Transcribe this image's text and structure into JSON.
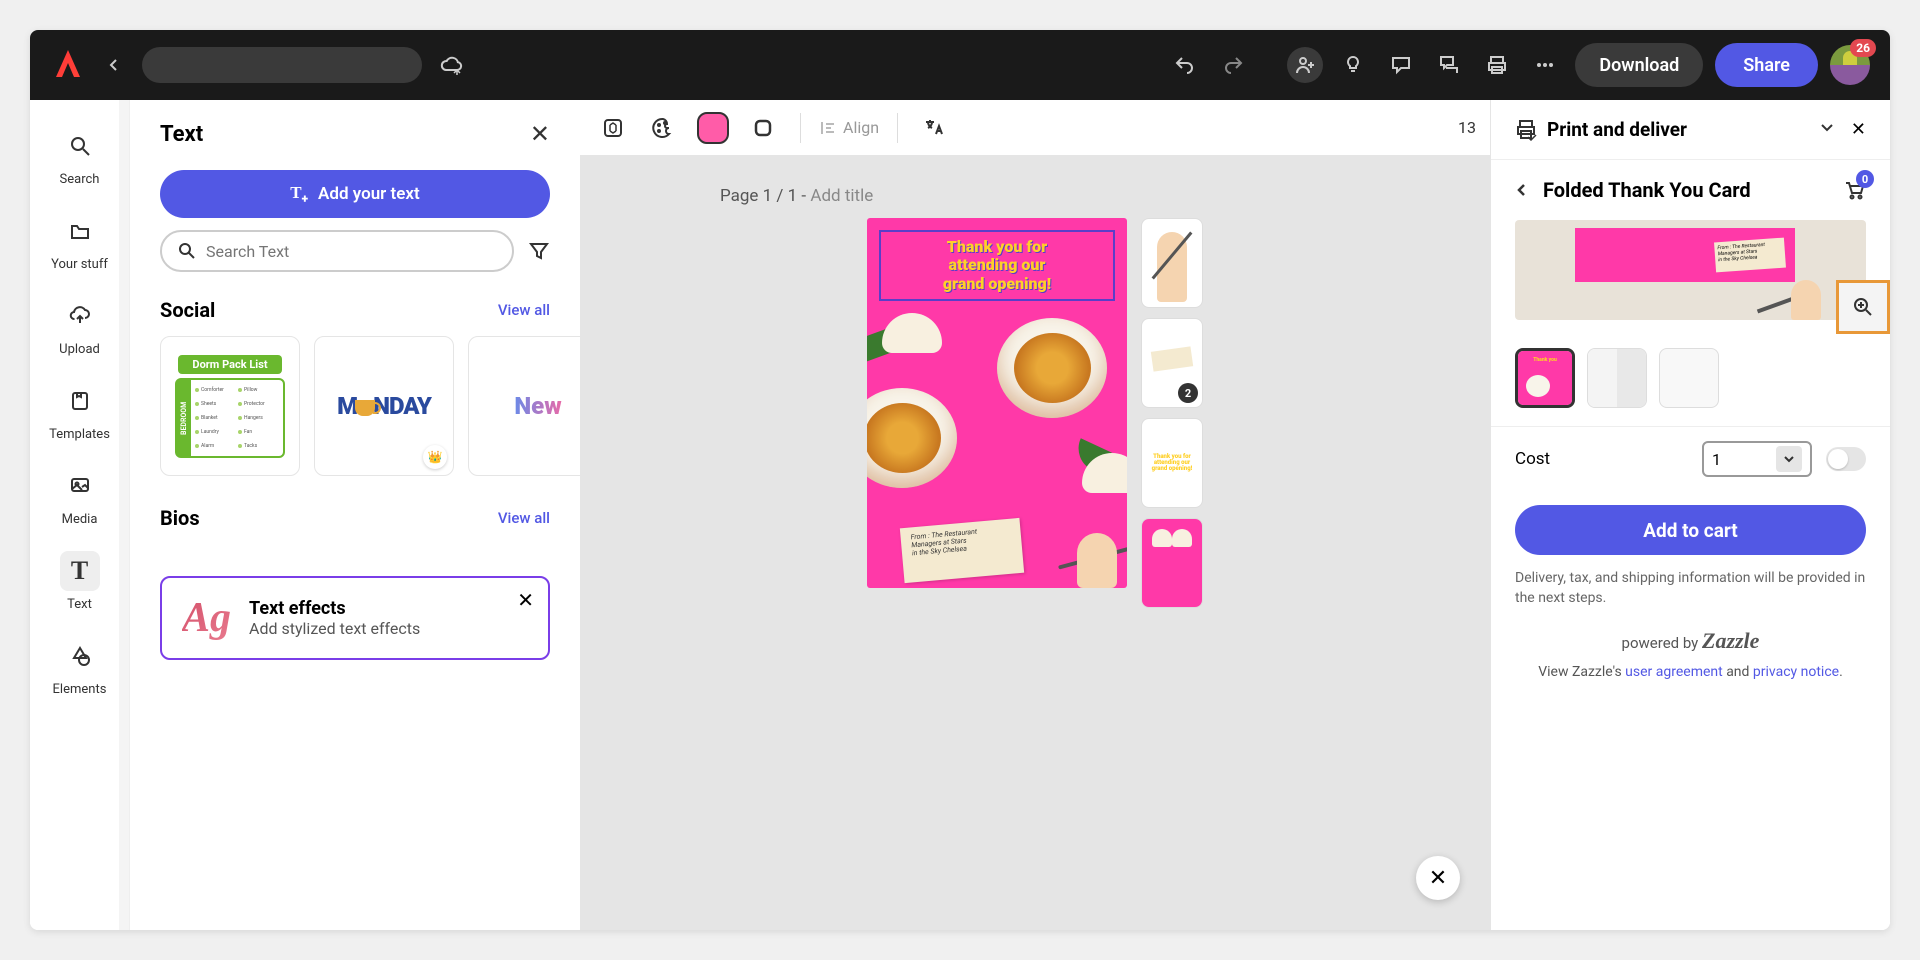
{
  "topbar": {
    "download": "Download",
    "share": "Share",
    "notif_count": "26"
  },
  "rail": {
    "search": "Search",
    "your_stuff": "Your stuff",
    "upload": "Upload",
    "templates": "Templates",
    "media": "Media",
    "text": "Text",
    "elements": "Elements"
  },
  "text_panel": {
    "title": "Text",
    "add_your_text": "Add your text",
    "search_placeholder": "Search Text",
    "social": "Social",
    "bios": "Bios",
    "view_all": "View all",
    "effects_title": "Text effects",
    "effects_sub": "Add stylized text effects",
    "thumbs": {
      "dorm_title": "Dorm Pack List",
      "dorm_side": "BEDROOM",
      "monday": "M NDAY",
      "new": "New"
    }
  },
  "canvas": {
    "align": "Align",
    "zoom": "13",
    "page_prefix": "Page 1 / 1 - ",
    "page_add": "Add title",
    "card_title_l1": "Thank you for",
    "card_title_l2": "attending our",
    "card_title_l3": "grand opening!",
    "note_l1": "From : The Restaurant",
    "note_l2": "Managers at Stars",
    "note_l3": "in the Sky Chelsea",
    "thumb_badge": "2"
  },
  "print": {
    "title": "Print and deliver",
    "crumb": "Folded Thank You Card",
    "cart_count": "0",
    "cost": "Cost",
    "qty": "1",
    "add_to_cart": "Add to cart",
    "disclaimer": "Delivery, tax, and shipping information will be provided in the next steps.",
    "powered_prefix": "powered by ",
    "powered_brand": "Zazzle",
    "legal_prefix": "View Zazzle's ",
    "legal_ua": "user agreement",
    "legal_and": " and ",
    "legal_pn": "privacy notice",
    "legal_dot": "."
  }
}
